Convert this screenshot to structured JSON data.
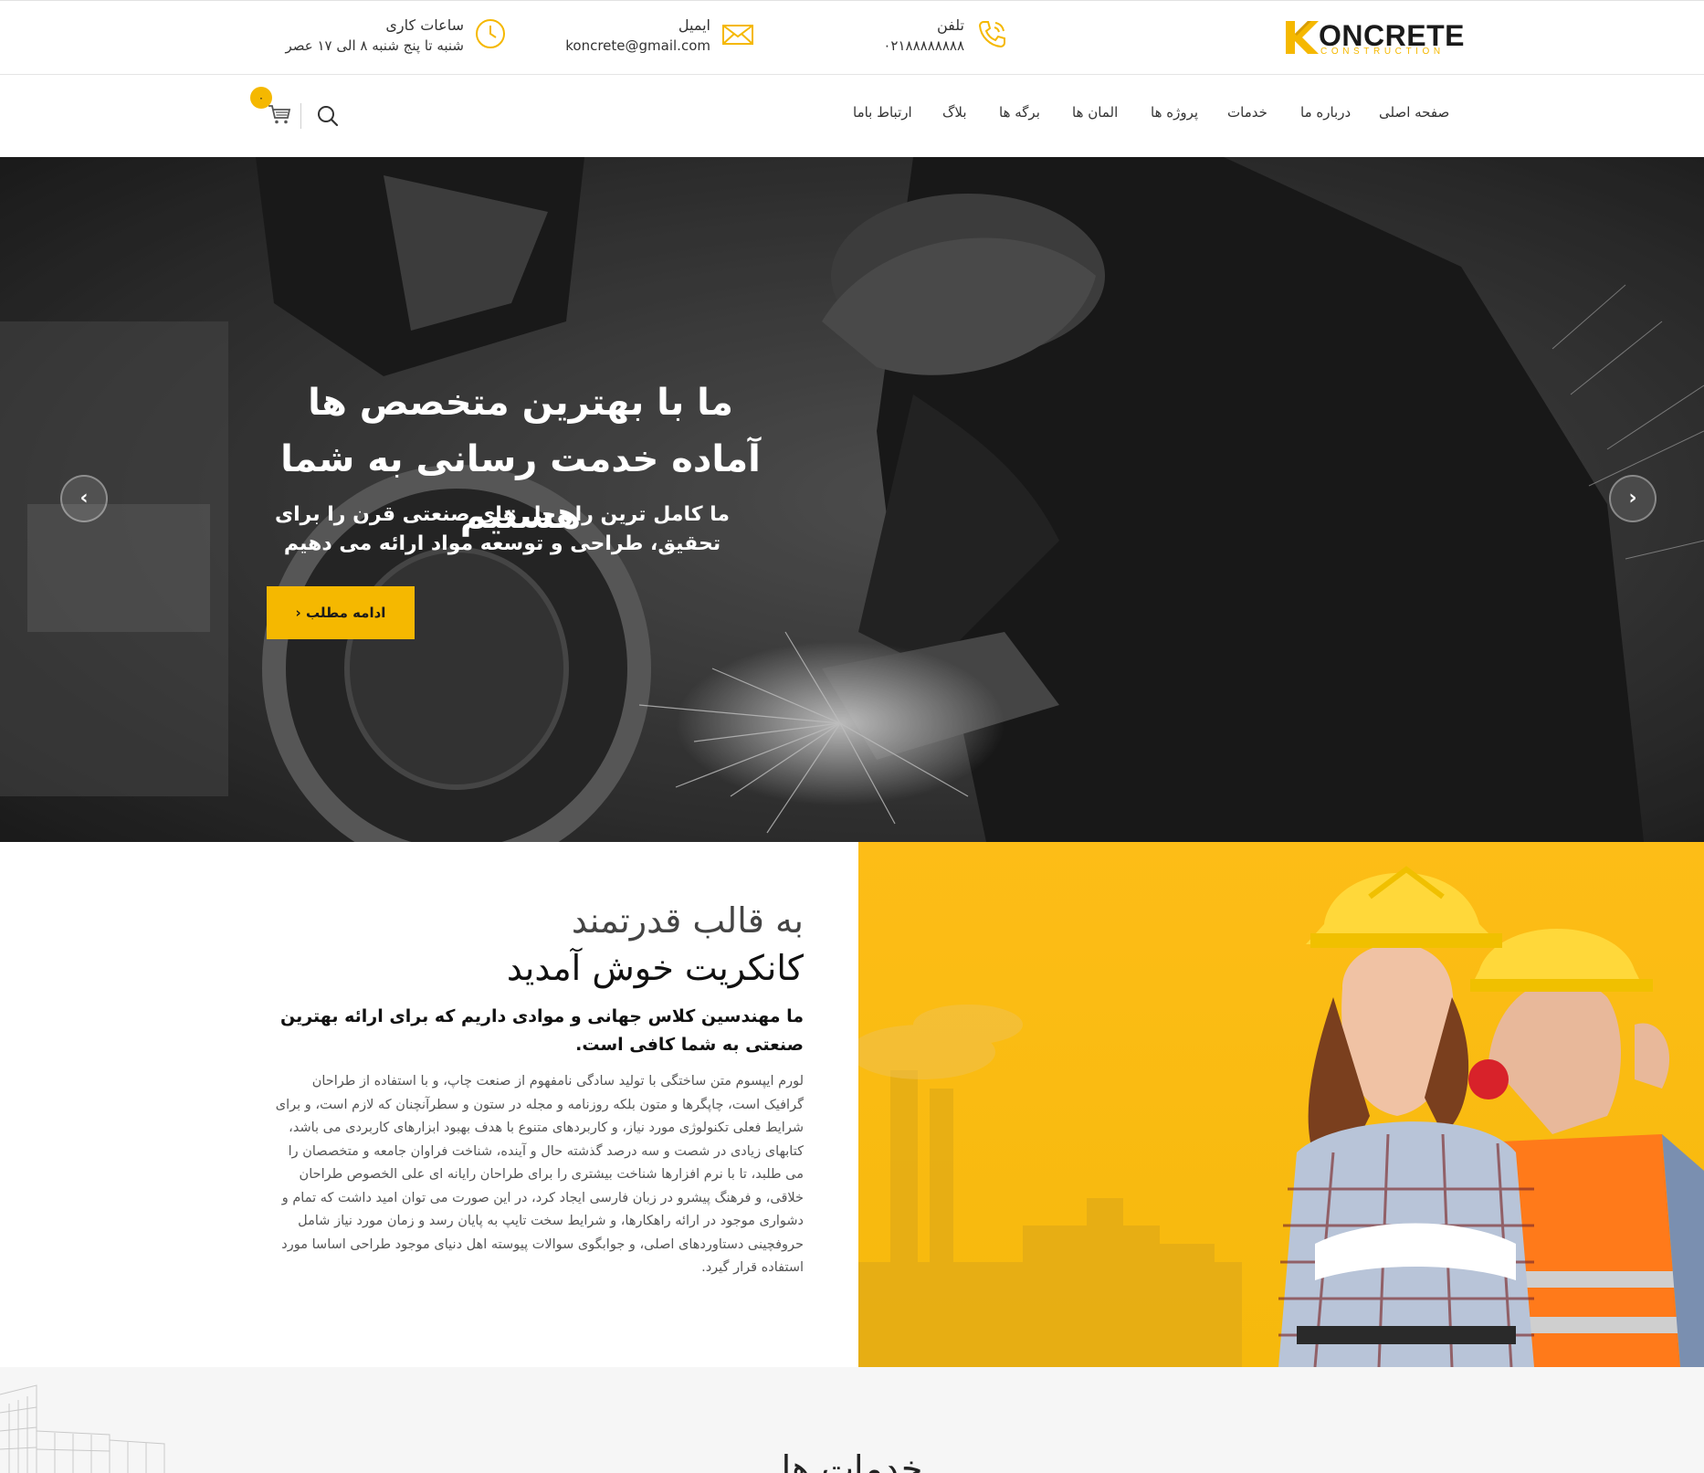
{
  "brand": {
    "name": "ONCRETE",
    "tagline": "CONSTRUCTION",
    "accent_color": "#f5b800"
  },
  "topbar": {
    "phone": {
      "label": "تلفن",
      "value": "۰۲۱۸۸۸۸۸۸۸۸",
      "icon": "phone-icon"
    },
    "email": {
      "label": "ایمیل",
      "value": "koncrete@gmail.com",
      "icon": "envelope-icon"
    },
    "hours": {
      "label": "ساعات کاری",
      "value": "شنبه تا پنج شنبه ۸ الی ۱۷ عصر",
      "icon": "clock-icon"
    }
  },
  "nav": {
    "items": [
      {
        "label": "صفحه اصلی"
      },
      {
        "label": "درباره ما"
      },
      {
        "label": "خدمات"
      },
      {
        "label": "پروژه ها"
      },
      {
        "label": "المان ها"
      },
      {
        "label": "برگه ها"
      },
      {
        "label": "بلاگ"
      },
      {
        "label": "ارتباط باما"
      }
    ],
    "cart_count": "۰",
    "search_icon": "search-icon",
    "cart_icon": "cart-icon"
  },
  "hero": {
    "title_line1": "ما با بهترین متخصص ها",
    "title_line2": "آماده خدمت رسانی به شما هستیم",
    "subtitle_line1": "ما کامل ترین راه حل های صنعتی قرن را برای",
    "subtitle_line2": "تحقیق، طراحی و توسعه مواد ارائه می دهیم",
    "button_label": "ادامه مطلب ‹",
    "prev_arrow": "‹",
    "next_arrow": "›"
  },
  "welcome": {
    "title_line1": "به قالب قدرتمند",
    "title_line2": "کانکریت خوش آمدید",
    "lead": "ما مهندسین کلاس جهانی و موادی داریم که برای ارائه بهترین صنعتی به شما کافی است.",
    "body": "لورم ایپسوم متن ساختگی با تولید سادگی نامفهوم از صنعت چاپ، و با استفاده از طراحان گرافیک است، چاپگرها و متون بلکه روزنامه و مجله در ستون و سطرآنچنان که لازم است، و برای شرایط فعلی تکنولوژی مورد نیاز، و کاربردهای متنوع با هدف بهبود ابزارهای کاربردی می باشد، کتابهای زیادی در شصت و سه درصد گذشته حال و آینده، شناخت فراوان جامعه و متخصصان را می طلبد، تا با نرم افزارها شناخت بیشتری را برای طراحان رایانه ای علی الخصوص طراحان خلاقی، و فرهنگ پیشرو در زبان فارسی ایجاد کرد، در این صورت می توان امید داشت که تمام و دشواری موجود در ارائه راهکارها، و شرایط سخت تایپ به پایان رسد و زمان مورد نیاز شامل حروفچینی دستاوردهای اصلی، و جوابگوی سوالات پیوسته اهل دنیای موجود طراحی اساسا مورد استفاده قرار گیرد."
  },
  "services": {
    "title": "خدمات ها"
  }
}
